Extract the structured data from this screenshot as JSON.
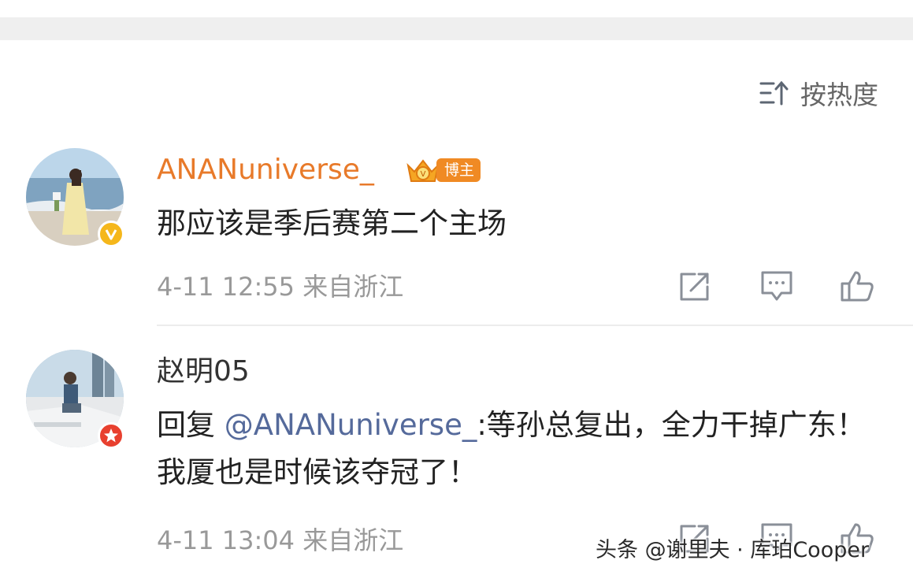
{
  "sort": {
    "label": "按热度",
    "icon": "sort-hot-icon"
  },
  "comments": [
    {
      "username": "ANANuniverse_",
      "username_color": "#e87a2a",
      "badge": {
        "icon": "verified-v-icon",
        "letter": "V",
        "color": "#f5b71b"
      },
      "blogger_tag": "博主",
      "text": "那应该是季后赛第二个主场",
      "time": "4-11 12:55",
      "location": "来自浙江"
    },
    {
      "username": "赵明05",
      "username_color": "#333333",
      "badge": {
        "icon": "member-star-icon",
        "color": "#e8402f"
      },
      "reply_prefix": "回复 ",
      "mention": "@ANANuniverse_",
      "text": ":等孙总复出，全力干掉广东！我厦也是时候该夺冠了！",
      "time": "4-11 13:04",
      "location": "来自浙江"
    }
  ],
  "watermark": "头条 @谢里夫 · 库珀Cooper"
}
